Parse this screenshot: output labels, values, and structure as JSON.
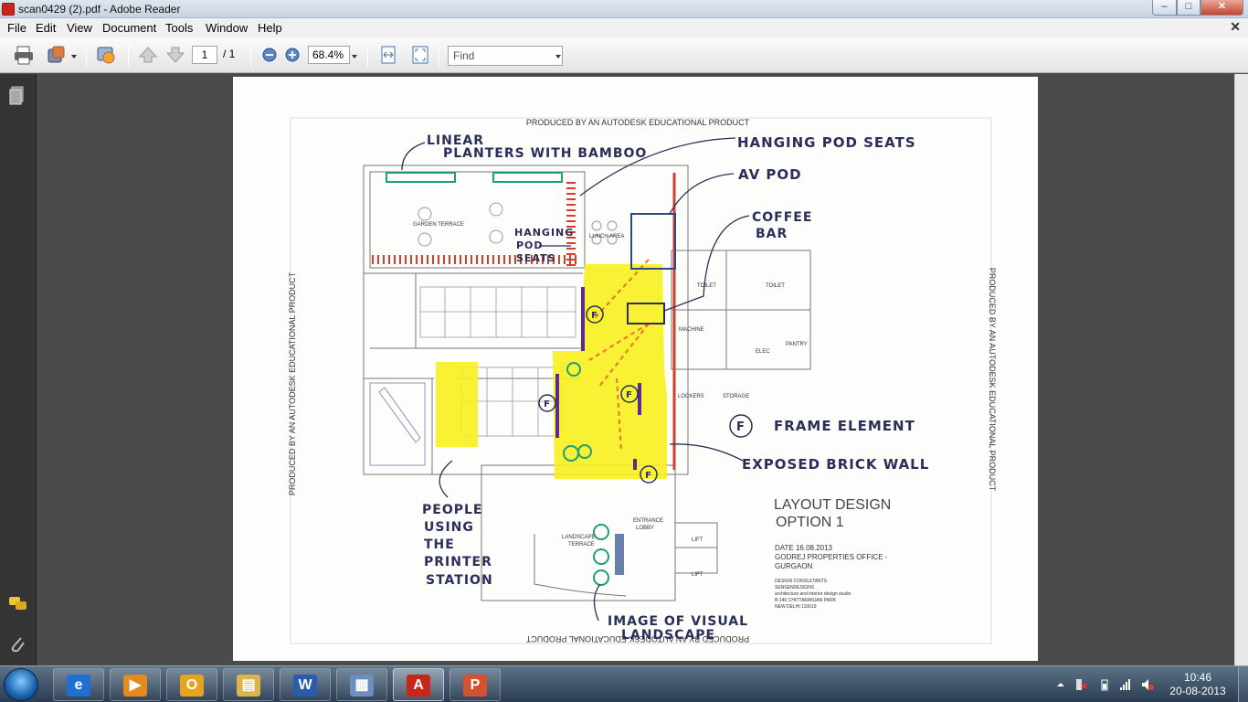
{
  "window": {
    "title": "scan0429 (2).pdf - Adobe Reader",
    "min_label": "–",
    "max_label": "□",
    "close_label": "✕"
  },
  "menu": {
    "items": [
      "File",
      "Edit",
      "View",
      "Document",
      "Tools",
      "Window",
      "Help"
    ],
    "doc_close": "✕"
  },
  "toolbar": {
    "page_current": "1",
    "page_total": "/ 1",
    "zoom": "68.4%",
    "find_placeholder": "Find",
    "icons": [
      "print-icon",
      "share-icon",
      "collaborate-icon",
      "prev-page-icon",
      "next-page-icon",
      "zoom-out-icon",
      "zoom-in-icon",
      "fit-width-icon",
      "fit-page-icon"
    ]
  },
  "navpane": {
    "icons": [
      "pages-icon",
      "comments-icon",
      "attachments-icon"
    ]
  },
  "document": {
    "watermark_top": "PRODUCED BY AN AUTODESK EDUCATIONAL PRODUCT",
    "watermark_left": "PRODUCED BY AN AUTODESK EDUCATIONAL PRODUCT",
    "watermark_right": "PRODUCED BY AN AUTODESK EDUCATIONAL PRODUCT",
    "watermark_bottom": "PRODUCED BY AN AUTODESK EDUCATIONAL PRODUCT",
    "annotations": {
      "linear_planters_1": "LINEAR",
      "linear_planters_2": "PLANTERS WITH BAMBOO",
      "hanging_pod_seats": "HANGING POD SEATS",
      "av_pod": "AV POD",
      "coffee_1": "COFFEE",
      "coffee_2": "BAR",
      "hanging_small_1": "HANGING",
      "hanging_small_2": "POD",
      "hanging_small_3": "SEATS",
      "frame_marker": "F",
      "frame_element": "FRAME ELEMENT",
      "exposed_brick": "EXPOSED BRICK WALL",
      "people_1": "PEOPLE",
      "people_2": "USING",
      "people_3": "THE",
      "people_4": "PRINTER",
      "people_5": "STATION",
      "image_1": "IMAGE OF VISUAL",
      "image_2": "LANDSCAPE"
    },
    "room_labels": {
      "garden_terrace": "GARDEN TERRACE",
      "lunch_area": "LUNCH AREA",
      "toilet_1": "TOILET",
      "toilet_2": "TOILET",
      "machine": "MACHINE",
      "elec": "ELEC",
      "pantry": "PANTRY",
      "lockers": "LOCKERS",
      "storage": "STORAGE",
      "entrance_lobby_1": "ENTRANCE",
      "entrance_lobby_2": "LOBBY",
      "landscape_terrace_1": "LANDSCAPE",
      "landscape_terrace_2": "TERRACE",
      "lift_1": "LIFT",
      "lift_2": "LIFT"
    },
    "title_block": {
      "title_1": "LAYOUT DESIGN",
      "title_2": "OPTION 1",
      "date": "DATE 16.08.2013",
      "client_1": "GODREJ PROPERTIES OFFICE -",
      "client_2": "GURGAON",
      "consultants_1": "DESIGN CONSULTANTS",
      "consultants_2": "SENSENDESIGNS",
      "consultants_3": "architecture and interior design studio",
      "consultants_4": "B-140 CHITTARANJAN PARK",
      "consultants_5": "NEW DELHI 110019"
    }
  },
  "taskbar": {
    "apps": [
      "internet-explorer-icon",
      "media-player-icon",
      "outlook-icon",
      "file-explorer-icon",
      "word-icon",
      "remote-desktop-icon",
      "adobe-reader-icon",
      "powerpoint-icon"
    ],
    "time": "10:46",
    "date": "20-08-2013"
  },
  "colors": {
    "highlight_yellow": "#f7ef1e",
    "marker_red": "#d83c2c",
    "marker_green": "#1f9e7a",
    "marker_purple": "#5b2c8f",
    "ink_navy": "#2a2f5a",
    "reader_red": "#c8261b"
  }
}
